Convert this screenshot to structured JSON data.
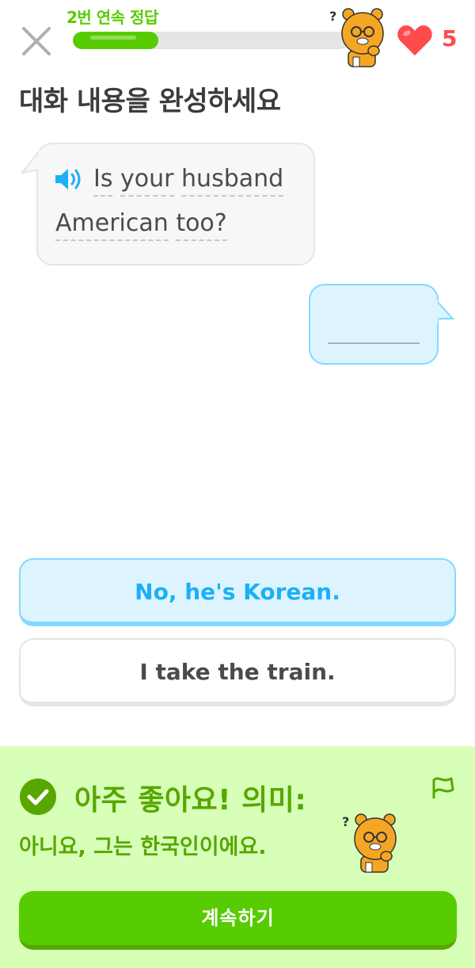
{
  "header": {
    "close_icon": "close-icon",
    "streak_label": "2번 연속 정답",
    "progress_fraction": 0.31,
    "hearts_count": "5",
    "heart_icon": "heart-icon",
    "mascot_icon": "thinking-lion-mascot"
  },
  "prompt": {
    "title": "대화 내용을 완성하세요"
  },
  "dialogue": {
    "speaker_icon": "speaker-icon",
    "line1_words": [
      "Is",
      "your",
      "husband"
    ],
    "line2_words": [
      "American",
      "too?"
    ]
  },
  "reply": {
    "blank": ""
  },
  "options": [
    {
      "label": "No, he's Korean.",
      "selected": true
    },
    {
      "label": "I take the train.",
      "selected": false
    }
  ],
  "feedback": {
    "status_icon": "check-icon",
    "title": "아주 좋아요! 의미:",
    "meaning": "아니요, 그는 한국인이에요.",
    "report_icon": "flag-icon",
    "continue_label": "계속하기"
  },
  "colors": {
    "green": "#58cc02",
    "dark_green": "#58a700",
    "feedback_bg": "#d7ffb8",
    "blue": "#1cb0f6",
    "light_blue": "#ddf4ff",
    "red": "#ff4b4b"
  }
}
